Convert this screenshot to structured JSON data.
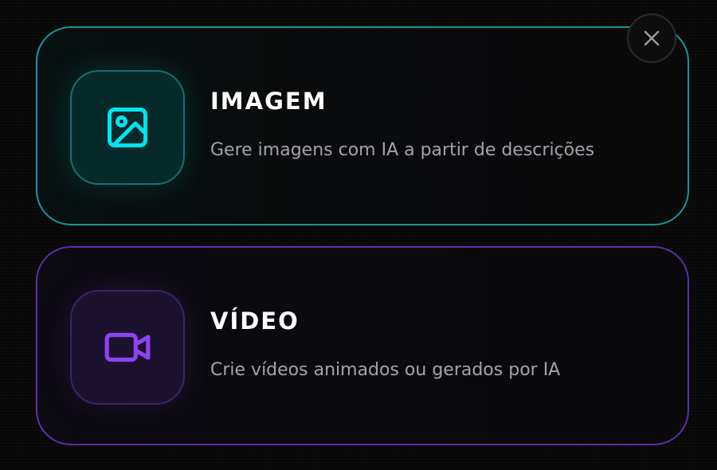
{
  "close_button": {
    "icon": "close-icon",
    "color": "#9b9ea1"
  },
  "options": [
    {
      "title": "IMAGEM",
      "description": "Gere imagens com IA a partir de descrições",
      "icon": "image-icon",
      "accent_color": "#00e5f0",
      "border_color": "#17969a"
    },
    {
      "title": "VÍDEO",
      "description": "Crie vídeos animados ou gerados por IA",
      "icon": "video-camera-icon",
      "accent_color": "#8b45f0",
      "border_color": "#5a2fa8"
    }
  ]
}
